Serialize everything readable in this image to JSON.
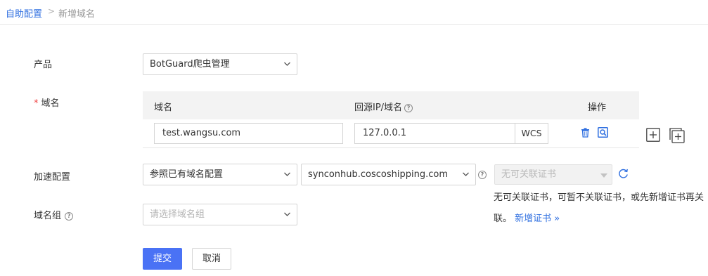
{
  "breadcrumb": {
    "parent": "自助配置",
    "separator": ">",
    "current": "新增域名"
  },
  "form": {
    "product_label": "产品",
    "product_value": "BotGuard爬虫管理",
    "domain_required_mark": "*",
    "domain_label": "域名",
    "table": {
      "col_domain": "域名",
      "col_origin": "回源IP/域名",
      "col_actions": "操作",
      "row": {
        "domain": "test.wangsu.com",
        "origin": "127.0.0.1",
        "origin_suffix": "WCS"
      }
    },
    "accel_label": "加速配置",
    "accel_mode": "参照已有域名配置",
    "accel_ref_domain": "synconhub.coscoshipping.com",
    "cert_select": "无可关联证书",
    "cert_note_line1": "无可关联证书，可暂不关联证书，或先新增证书再关",
    "cert_note_line2": "联。",
    "cert_new_link": "新增证书 »",
    "group_label": "域名组",
    "group_placeholder": "请选择域名组"
  },
  "buttons": {
    "submit": "提交",
    "cancel": "取消"
  },
  "icons": {
    "help": "?",
    "chevron": "⌄"
  },
  "colors": {
    "accent": "#4a72f5",
    "link": "#2f6fe0",
    "required": "#f04848"
  }
}
